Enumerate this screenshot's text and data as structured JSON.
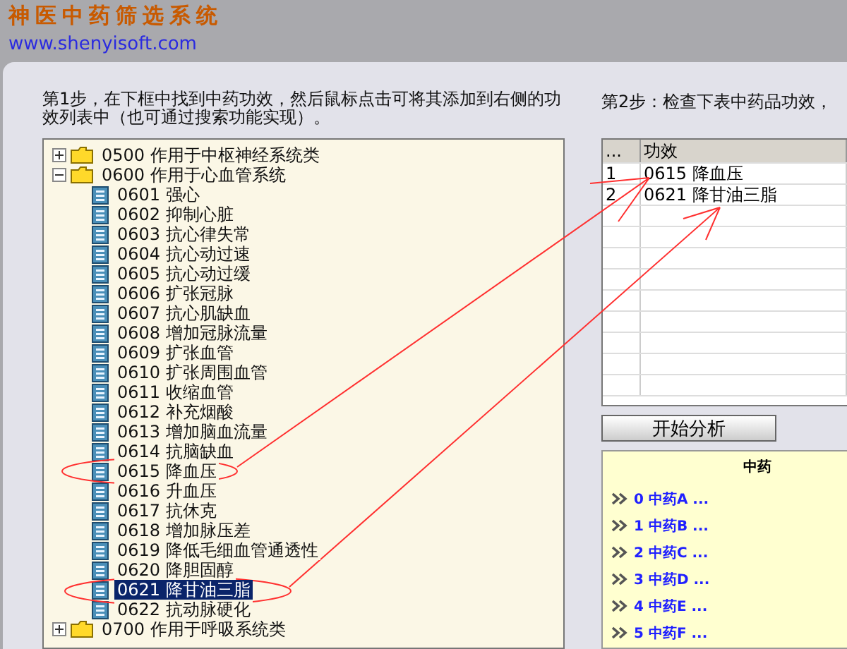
{
  "header": {
    "title": "神医中药筛选系统",
    "url": "www.shenyisoft.com"
  },
  "step1": {
    "text": "第1步，在下框中找到中药功效，然后鼠标点击可将其添加到右侧的功效列表中（也可通过搜索功能实现）。"
  },
  "tree": [
    {
      "code": "0500",
      "label": "作用于中枢神经系统类",
      "expanded": false,
      "selected": false
    },
    {
      "code": "0600",
      "label": "作用于心血管系统",
      "expanded": true,
      "selected": false,
      "children": [
        {
          "code": "0601",
          "label": "强心",
          "selected": false
        },
        {
          "code": "0602",
          "label": "抑制心脏",
          "selected": false
        },
        {
          "code": "0603",
          "label": "抗心律失常",
          "selected": false
        },
        {
          "code": "0604",
          "label": "抗心动过速",
          "selected": false
        },
        {
          "code": "0605",
          "label": "抗心动过缓",
          "selected": false
        },
        {
          "code": "0606",
          "label": "扩张冠脉",
          "selected": false
        },
        {
          "code": "0607",
          "label": "抗心肌缺血",
          "selected": false
        },
        {
          "code": "0608",
          "label": "增加冠脉流量",
          "selected": false
        },
        {
          "code": "0609",
          "label": "扩张血管",
          "selected": false
        },
        {
          "code": "0610",
          "label": "扩张周围血管",
          "selected": false
        },
        {
          "code": "0611",
          "label": "收缩血管",
          "selected": false
        },
        {
          "code": "0612",
          "label": "补充烟酸",
          "selected": false
        },
        {
          "code": "0613",
          "label": "增加脑血流量",
          "selected": false
        },
        {
          "code": "0614",
          "label": "抗脑缺血",
          "selected": false
        },
        {
          "code": "0615",
          "label": "降血压",
          "selected": false
        },
        {
          "code": "0616",
          "label": "升血压",
          "selected": false
        },
        {
          "code": "0617",
          "label": "抗休克",
          "selected": false
        },
        {
          "code": "0618",
          "label": "增加脉压差",
          "selected": false
        },
        {
          "code": "0619",
          "label": "降低毛细血管通透性",
          "selected": false
        },
        {
          "code": "0620",
          "label": "降胆固醇",
          "selected": false
        },
        {
          "code": "0621",
          "label": "降甘油三脂",
          "selected": true
        },
        {
          "code": "0622",
          "label": "抗动脉硬化",
          "selected": false
        }
      ]
    },
    {
      "code": "0700",
      "label": "作用于呼吸系统类",
      "expanded": false,
      "selected": false
    }
  ],
  "step2": {
    "text": "第2步：检查下表中药品功效，"
  },
  "table": {
    "columns": [
      "...",
      "功效"
    ],
    "rows": [
      {
        "index": "1",
        "effect": "0615 降血压"
      },
      {
        "index": "2",
        "effect": "0621 降甘油三脂"
      }
    ]
  },
  "analyze_button": "开始分析",
  "results": {
    "header": "中药",
    "items": [
      "0 中药A ...",
      "1 中药B ...",
      "2 中药C ...",
      "3 中药D ...",
      "4 中药E ...",
      "5 中药F ..."
    ]
  }
}
